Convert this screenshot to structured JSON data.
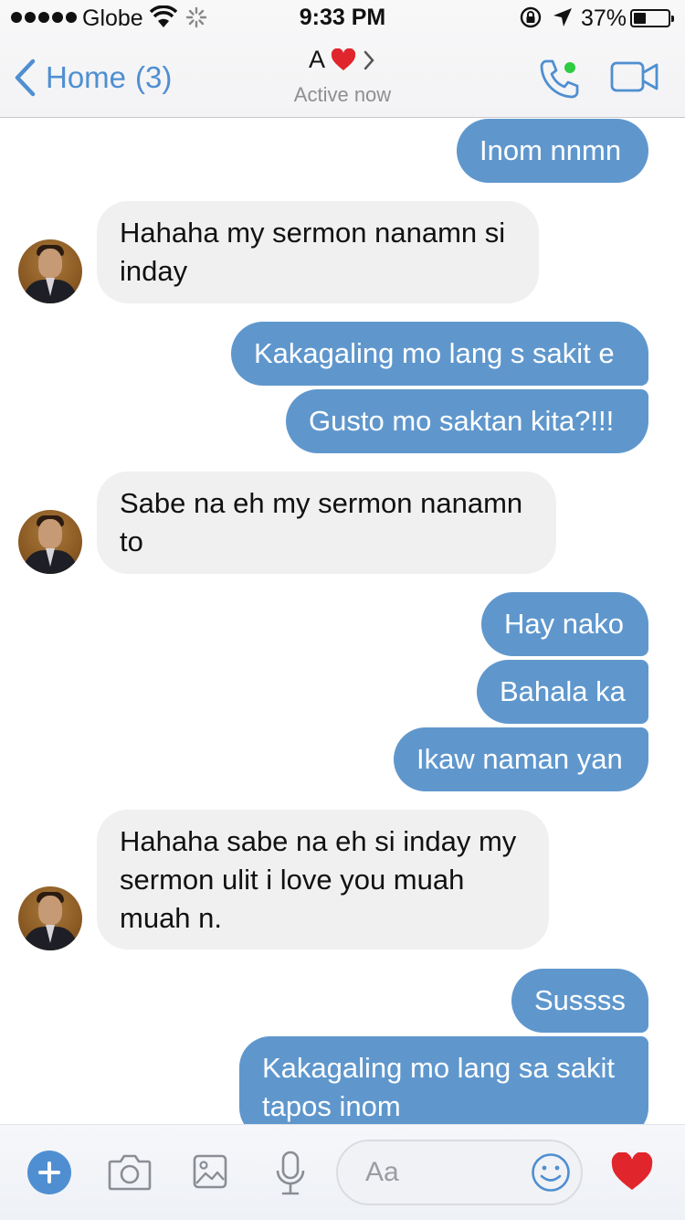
{
  "status": {
    "carrier": "Globe",
    "time": "9:33 PM",
    "battery": "37%",
    "battery_level": 0.37
  },
  "nav": {
    "back_label": "Home",
    "back_count": "(3)",
    "contact_name": "A",
    "status_text": "Active now",
    "heart_color": "#e0262c",
    "accent_color": "#4f8fd1",
    "online_color": "#2ecc40"
  },
  "messages": [
    {
      "from": "me",
      "text": "Inom nnmn"
    },
    {
      "from": "them",
      "text": "Hahaha my sermon nanamn si inday"
    },
    {
      "from": "me",
      "text": "Kakagaling mo lang s sakit e"
    },
    {
      "from": "me",
      "text": "Gusto mo saktan kita?!!!"
    },
    {
      "from": "them",
      "text": "Sabe na eh my sermon nanamn to"
    },
    {
      "from": "me",
      "text": "Hay nako"
    },
    {
      "from": "me",
      "text": "Bahala ka"
    },
    {
      "from": "me",
      "text": "Ikaw naman yan"
    },
    {
      "from": "them",
      "text": "Hahaha sabe na eh si inday my sermon ulit i love you muah muah n."
    },
    {
      "from": "me",
      "text": "Sussss"
    },
    {
      "from": "me",
      "text": "Kakagaling mo lang sa sakit tapos inom"
    }
  ],
  "colors": {
    "outgoing_bubble": "#5f97cd",
    "incoming_bubble": "#f0f0f0"
  },
  "composer": {
    "placeholder": "Aa",
    "icons": [
      "plus-icon",
      "camera-icon",
      "gallery-icon",
      "microphone-icon",
      "emoji-icon",
      "heart-icon"
    ]
  }
}
